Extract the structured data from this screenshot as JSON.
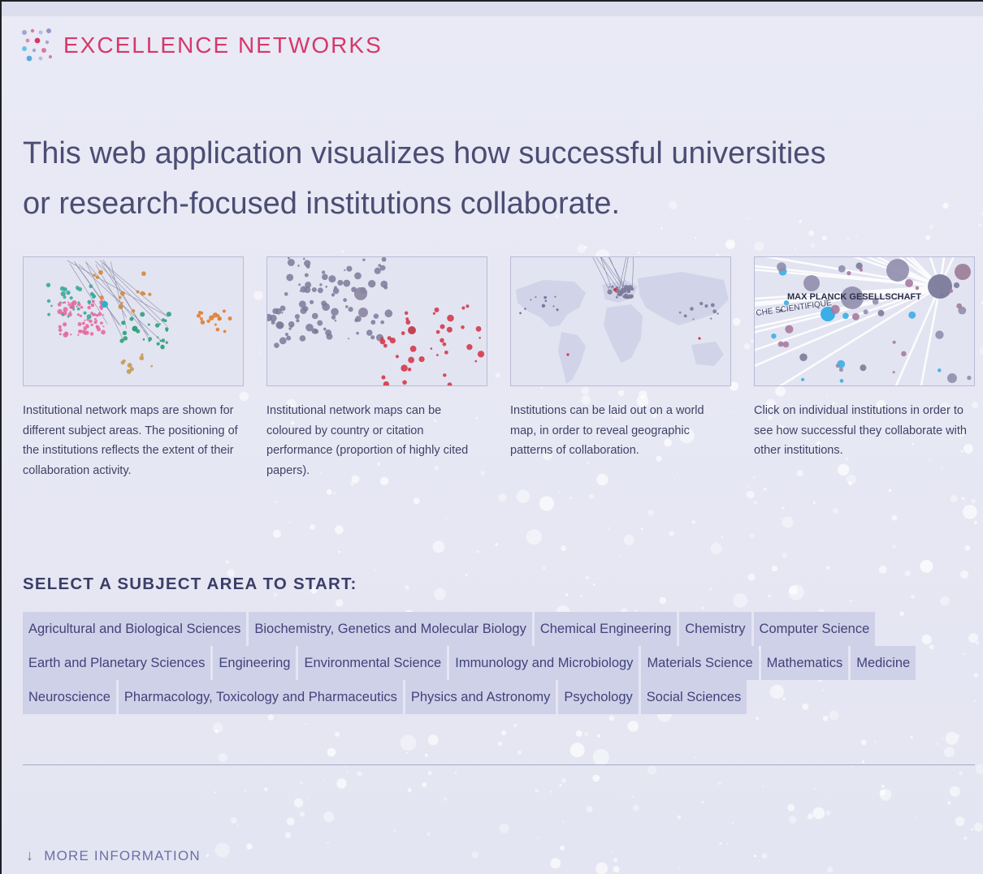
{
  "brand": {
    "title": "EXCELLENCE NETWORKS",
    "logo_icon": "network-dots-icon"
  },
  "headline": {
    "line1": "This web application visualizes how successful universities",
    "line2": "or research-focused institutions collaborate."
  },
  "cards": [
    {
      "image": "subject-network-map",
      "text": "Institutional network maps are shown for different subject areas. The positioning of the institutions reflects the extent of their collaboration activity."
    },
    {
      "image": "country-colour-map",
      "text": "Institutional network maps can be coloured by country or citation performance (proportion of highly cited papers)."
    },
    {
      "image": "world-map",
      "text": "Institutions can be laid out on a world map, in order to reveal geographic patterns of collaboration."
    },
    {
      "image": "institution-detail",
      "text": "Click on individual institutions in order to see how successful they collaborate with other institutions.",
      "labels": [
        "MAX PLANCK GESELLSCHAFT",
        "CHE SCIENTIFIQUE"
      ]
    }
  ],
  "select": {
    "heading": "SELECT A SUBJECT AREA TO START:",
    "rows": [
      [
        "Agricultural and Biological Sciences",
        "Biochemistry, Genetics and Molecular Biology",
        "Chemical Engineering",
        "Chemistry",
        "Computer Science"
      ],
      [
        "Earth and Planetary Sciences",
        "Engineering",
        "Environmental Science",
        "Immunology and Microbiology",
        "Materials Science",
        "Mathematics",
        "Medicine"
      ],
      [
        "Neuroscience",
        "Pharmacology, Toxicology and Pharmaceutics",
        "Physics and Astronomy",
        "Psychology",
        "Social Sciences"
      ]
    ]
  },
  "more_info": {
    "arrow": "↓",
    "label": "MORE INFORMATION"
  },
  "colors": {
    "accent": "#d6386b",
    "text": "#3d3f66",
    "button_bg": "#cfd1e8",
    "link": "#6b6fa6"
  }
}
